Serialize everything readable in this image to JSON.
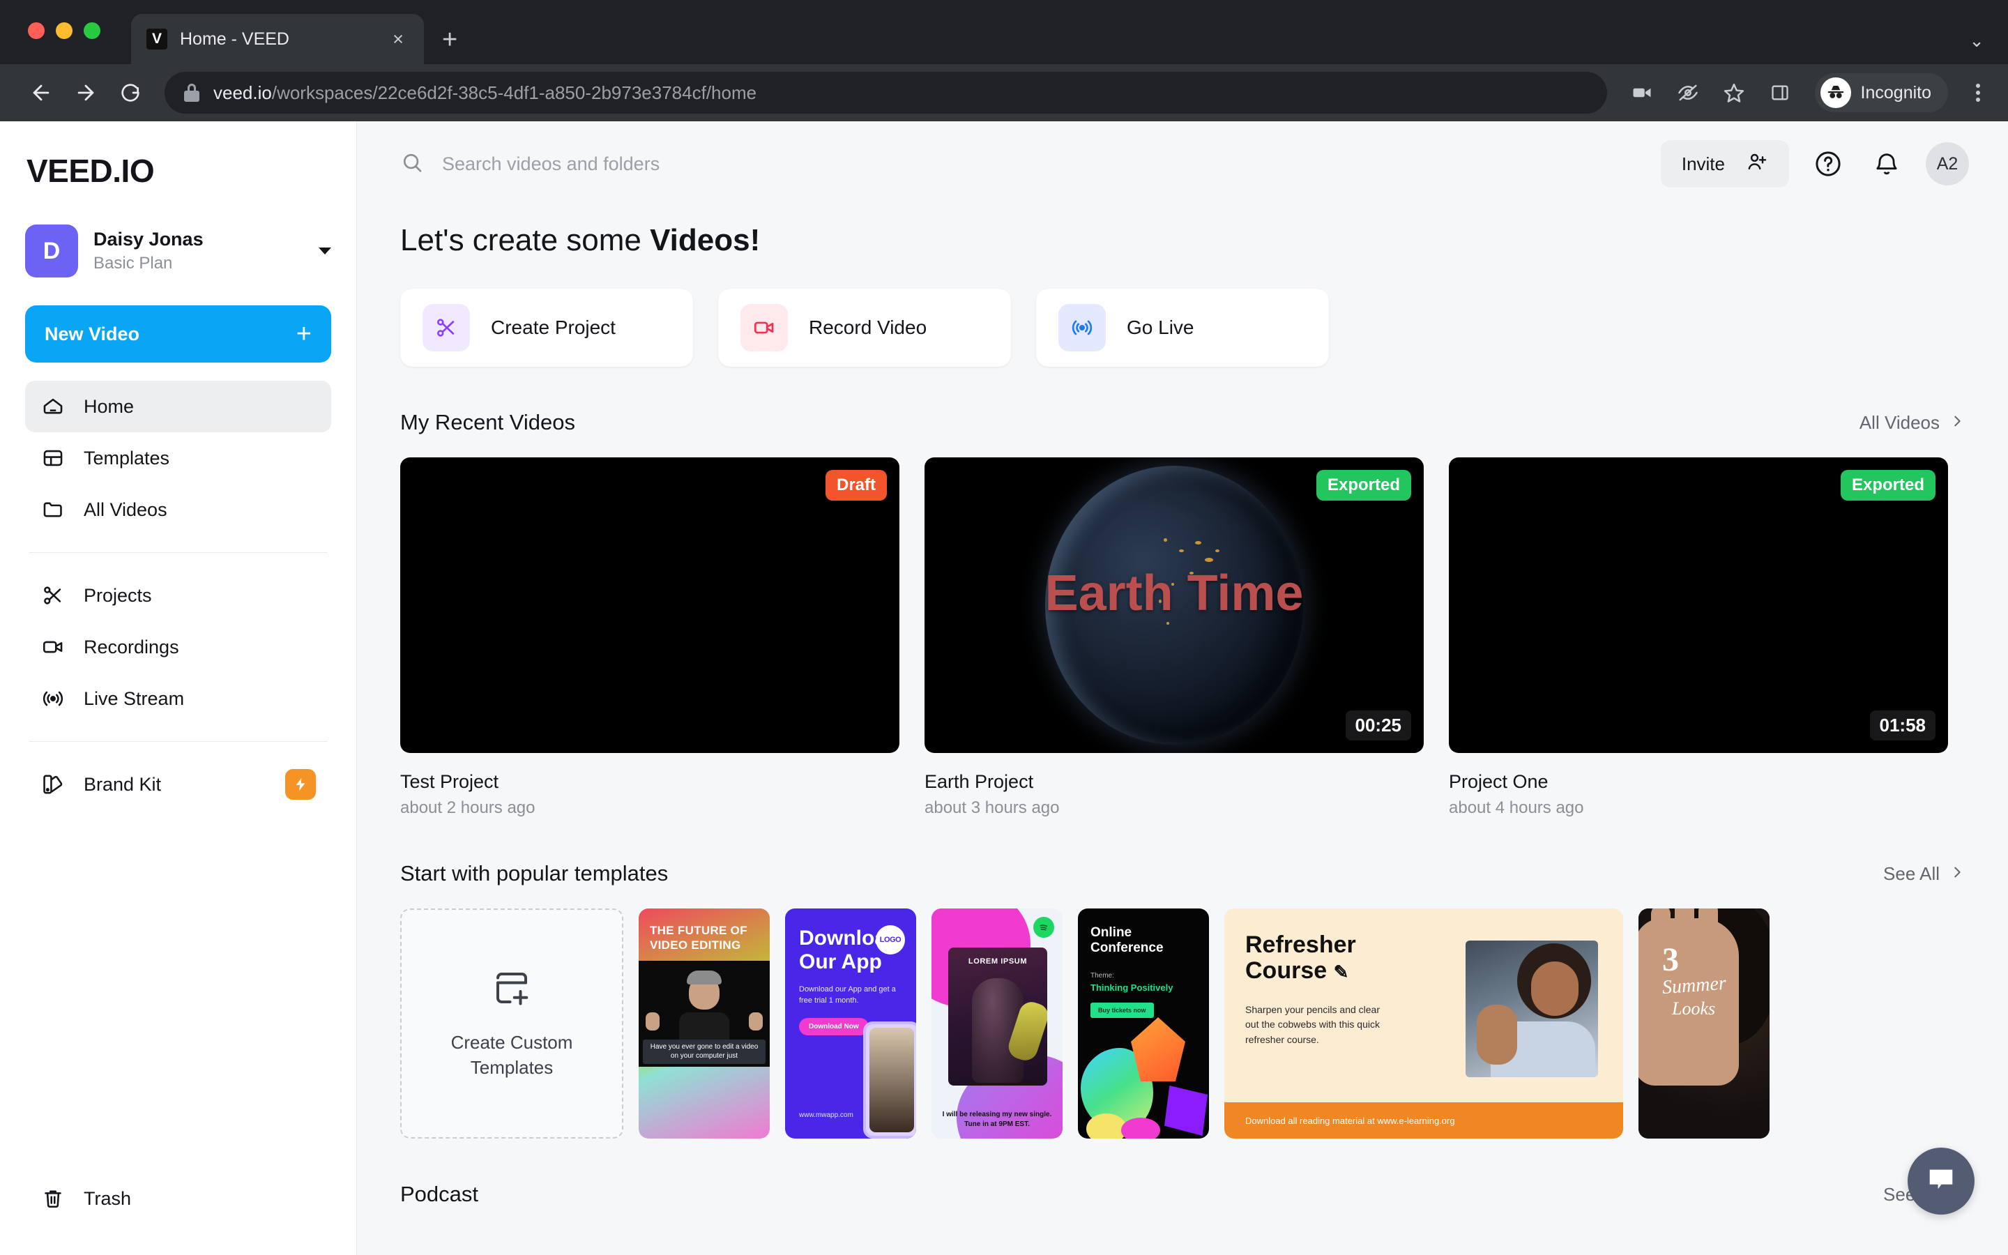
{
  "browser": {
    "tab_title": "Home - VEED",
    "favicon_letter": "V",
    "close_label": "×",
    "newtab_label": "+",
    "tablist_label": "⌄",
    "url_domain": "veed.io",
    "url_path": "/workspaces/22ce6d2f-38c5-4df1-a850-2b973e3784cf/home",
    "profile_label": "Incognito"
  },
  "sidebar": {
    "logo": "VEED.IO",
    "workspace": {
      "avatar_letter": "D",
      "name": "Daisy Jonas",
      "plan": "Basic Plan"
    },
    "new_video": {
      "label": "New Video",
      "plus": "+"
    },
    "items": [
      {
        "label": "Home",
        "icon": "home-icon",
        "active": true
      },
      {
        "label": "Templates",
        "icon": "templates-icon",
        "active": false
      },
      {
        "label": "All Videos",
        "icon": "folder-icon",
        "active": false
      },
      {
        "label": "Projects",
        "icon": "scissors-icon",
        "active": false
      },
      {
        "label": "Recordings",
        "icon": "video-camera-icon",
        "active": false
      },
      {
        "label": "Live Stream",
        "icon": "broadcast-icon",
        "active": false
      },
      {
        "label": "Brand Kit",
        "icon": "palette-icon",
        "active": false,
        "badge": "lightning"
      }
    ],
    "trash": {
      "label": "Trash",
      "icon": "trash-icon"
    }
  },
  "topbar": {
    "search_placeholder": "Search videos and folders",
    "invite_label": "Invite",
    "help_icon": "question-mark-icon",
    "bell_icon": "notification-bell-icon",
    "avatar_label": "A2"
  },
  "main": {
    "heading_prefix": "Let's create some ",
    "heading_bold": "Videos!",
    "actions": [
      {
        "label": "Create Project",
        "icon": "scissors-icon",
        "bg": "#f1e9ff",
        "fg": "#8b3ff5"
      },
      {
        "label": "Record Video",
        "icon": "video-camera-icon",
        "bg": "#ffe9ec",
        "fg": "#f5304f"
      },
      {
        "label": "Go Live",
        "icon": "broadcast-icon",
        "bg": "#e4e9ff",
        "fg": "#1d7cf2"
      }
    ],
    "recent": {
      "title": "My Recent Videos",
      "see_all": "All Videos",
      "videos": [
        {
          "title": "Test Project",
          "time": "about 2 hours ago",
          "badge": "Draft",
          "badge_color": "#f25529",
          "duration": ""
        },
        {
          "title": "Earth Project",
          "time": "about 3 hours ago",
          "badge": "Exported",
          "badge_color": "#22c55e",
          "duration": "00:25",
          "thumb_text": "Earth Time"
        },
        {
          "title": "Project One",
          "time": "about 4 hours ago",
          "badge": "Exported",
          "badge_color": "#22c55e",
          "duration": "01:58"
        }
      ]
    },
    "templates": {
      "title": "Start with popular templates",
      "see_all": "See All",
      "custom": {
        "label_line1": "Create Custom",
        "label_line2": "Templates",
        "icon": "add-template-icon"
      },
      "items": [
        {
          "name": "future-of-video-editing",
          "title_line1": "THE FUTURE OF",
          "title_line2": "VIDEO EDITING",
          "caption": "Have you ever gone to edit a video on your computer just"
        },
        {
          "name": "download-our-app",
          "title_line1": "Download",
          "title_line2": "Our App",
          "sub": "Download our App and get a free trial 1 month.",
          "cta": "Download Now",
          "www": "www.mwapp.com",
          "logo": "LOGO"
        },
        {
          "name": "lorem-ipsum-music",
          "poster_title": "LOREM IPSUM",
          "caption": "I will be releasing my new single. Tune in at 9PM EST."
        },
        {
          "name": "online-conference",
          "title_line1": "Online",
          "title_line2": "Conference",
          "theme_label": "Theme:",
          "theme_value": "Thinking Positively",
          "cta": "Buy tickets now"
        },
        {
          "name": "refresher-course",
          "title_line1": "Refresher",
          "title_line2": "Course",
          "body": "Sharpen your pencils and clear out the cobwebs with this quick refresher course.",
          "footer": "Download all reading material at www.e-learning.org"
        },
        {
          "name": "summer-looks",
          "number": "3",
          "word1": "Summer",
          "word2": "Looks"
        }
      ]
    },
    "podcast": {
      "title": "Podcast",
      "see_all": "See All"
    }
  },
  "fab": {
    "icon": "chat-bubble-icon"
  }
}
